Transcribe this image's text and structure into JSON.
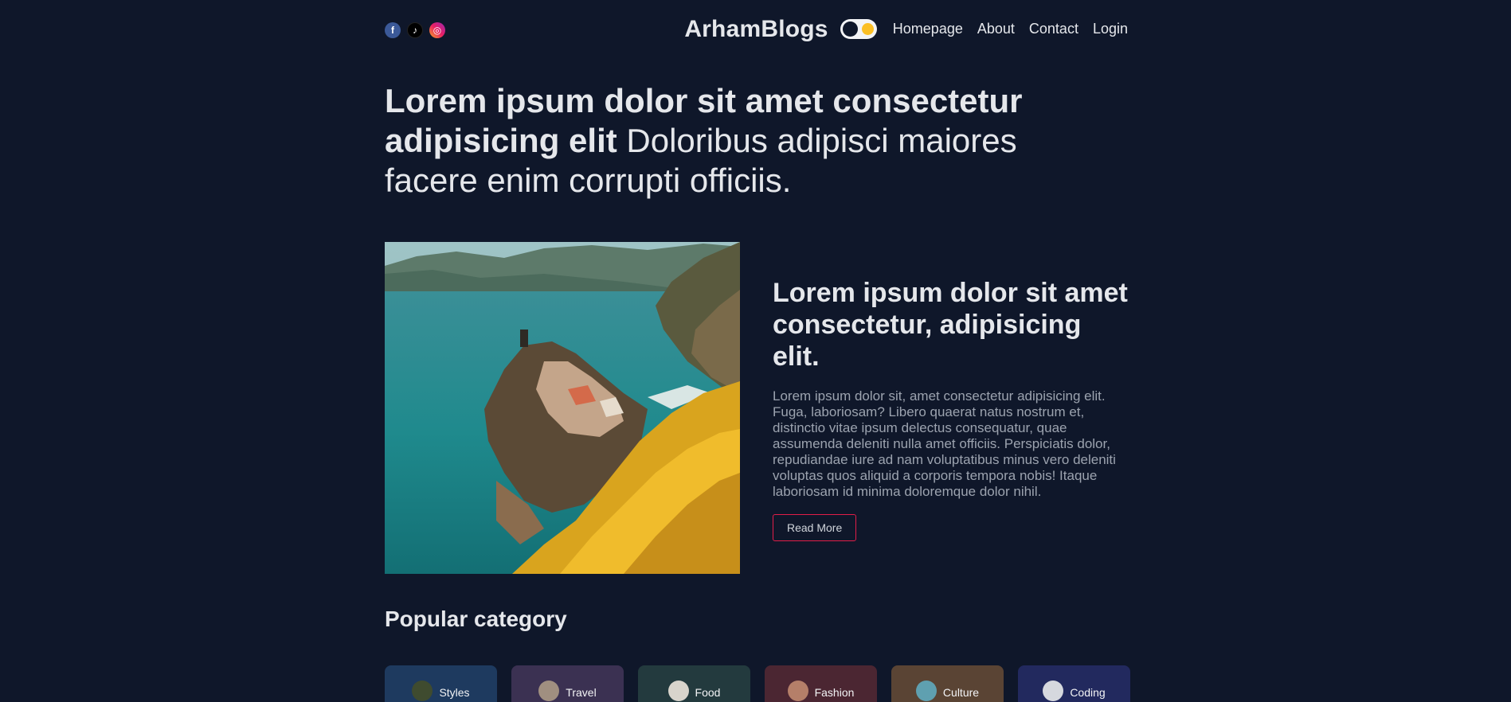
{
  "navbar": {
    "brand": "ArhamBlogs",
    "socials": [
      {
        "name": "facebook",
        "glyph": "f"
      },
      {
        "name": "tiktok",
        "glyph": "♪"
      },
      {
        "name": "instagram",
        "glyph": "◎"
      }
    ],
    "links": [
      "Homepage",
      "About",
      "Contact",
      "Login"
    ]
  },
  "hero": {
    "bold": "Lorem ipsum dolor sit amet consectetur adipisicing elit",
    "light": " Doloribus adipisci maiores facere enim corrupti officiis."
  },
  "featured": {
    "title": "Lorem ipsum dolor sit amet consectetur, adipisicing elit.",
    "body": "Lorem ipsum dolor sit, amet consectetur adipisicing elit. Fuga, laboriosam? Libero quaerat natus nostrum et, distinctio vitae ipsum delectus consequatur, quae assumenda deleniti nulla amet officiis. Perspiciatis dolor, repudiandae iure ad nam voluptatibus minus vero deleniti voluptas quos aliquid a corporis tempora nobis! Itaque laboriosam id minima doloremque dolor nihil.",
    "button": "Read More"
  },
  "popular": {
    "title": "Popular category",
    "categories": [
      {
        "label": "Styles",
        "bg": "#1e3a5f",
        "avatar": "#3f4b2f"
      },
      {
        "label": "Travel",
        "bg": "#3b3152",
        "avatar": "#a08f80"
      },
      {
        "label": "Food",
        "bg": "#233a3e",
        "avatar": "#d8d4cc"
      },
      {
        "label": "Fashion",
        "bg": "#4b2632",
        "avatar": "#b57f69"
      },
      {
        "label": "Culture",
        "bg": "#5a4434",
        "avatar": "#5fa0b0"
      },
      {
        "label": "Coding",
        "bg": "#22295e",
        "avatar": "#d6d8de"
      }
    ]
  },
  "colors": {
    "background": "#0f172a",
    "accent": "#e11d48",
    "toggle_sun": "#fbbf24"
  }
}
